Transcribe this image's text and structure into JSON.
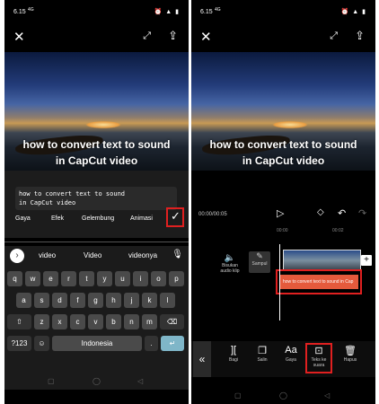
{
  "panel1": {
    "status": {
      "time": "6.15",
      "signal_text": "4G",
      "icons": "⏰ ▲ ▮"
    },
    "topbar": {
      "close_icon": "close-icon",
      "fullscreen_icon": "fullscreen-icon",
      "export_icon": "export-icon"
    },
    "video_caption": [
      "how to convert text to sound",
      "in CapCut video"
    ],
    "textbox": {
      "line1": "how to convert text to sound",
      "line2": "in CapCut video"
    },
    "tabs": [
      "Gaya",
      "Efek",
      "Gelembung",
      "Animasi"
    ],
    "suggestions": [
      "video",
      "Video",
      "videonya"
    ],
    "keys": {
      "row1": [
        "q",
        "w",
        "e",
        "r",
        "t",
        "y",
        "u",
        "i",
        "o",
        "p"
      ],
      "row2": [
        "a",
        "s",
        "d",
        "f",
        "g",
        "h",
        "j",
        "k",
        "l"
      ],
      "row3": [
        "z",
        "x",
        "c",
        "v",
        "b",
        "n",
        "m"
      ],
      "numkey": "?123",
      "space": "Indonesia",
      "period": "."
    }
  },
  "panel2": {
    "status": {
      "time": "6.15",
      "signal_text": "4G"
    },
    "caption": [
      "how to convert text to sound",
      "in CapCut video"
    ],
    "timecode": "00:00/00:05",
    "ruler": [
      "00:00",
      "00:02"
    ],
    "track": {
      "mute_label": "Bisukan audio klip",
      "cover_label": "Sampul"
    },
    "text_clip": "how to convert text to sound in Cap",
    "tools": [
      "Bagi",
      "Salin",
      "Gaya",
      "Teks ke suara",
      "Hapus"
    ]
  }
}
